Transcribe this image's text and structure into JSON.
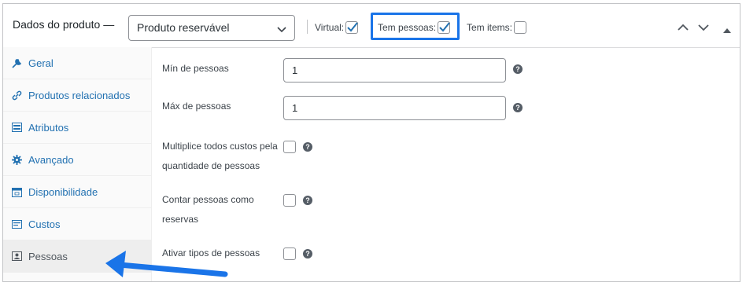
{
  "header": {
    "title": "Dados do produto —",
    "product_type": "Produto reservável",
    "options": [
      {
        "label": "Virtual:",
        "checked": true
      },
      {
        "label": "Tem pessoas:",
        "checked": true
      },
      {
        "label": "Tem items:",
        "checked": false
      }
    ]
  },
  "sidebar": {
    "items": [
      {
        "label": "Geral",
        "icon": "wrench-icon"
      },
      {
        "label": "Produtos relacionados",
        "icon": "link-icon"
      },
      {
        "label": "Atributos",
        "icon": "list-icon"
      },
      {
        "label": "Avançado",
        "icon": "gear-icon"
      },
      {
        "label": "Disponibilidade",
        "icon": "calendar-icon"
      },
      {
        "label": "Custos",
        "icon": "money-icon"
      },
      {
        "label": "Pessoas",
        "icon": "person-card-icon",
        "active": true
      }
    ]
  },
  "fields": {
    "min_label": "Mín de pessoas",
    "min_value": "1",
    "max_label": "Máx de pessoas",
    "max_value": "1",
    "multiply_label_line1": "Multiplice todos custos pela",
    "multiply_label_line2": "quantidade de pessoas",
    "count_label_line1": "Contar pessoas como",
    "count_label_line2": "reservas",
    "types_label": "Ativar tipos de pessoas"
  },
  "colors": {
    "link": "#2271b1",
    "highlight": "#1a74e8",
    "checkbox_check": "#2271b1"
  }
}
